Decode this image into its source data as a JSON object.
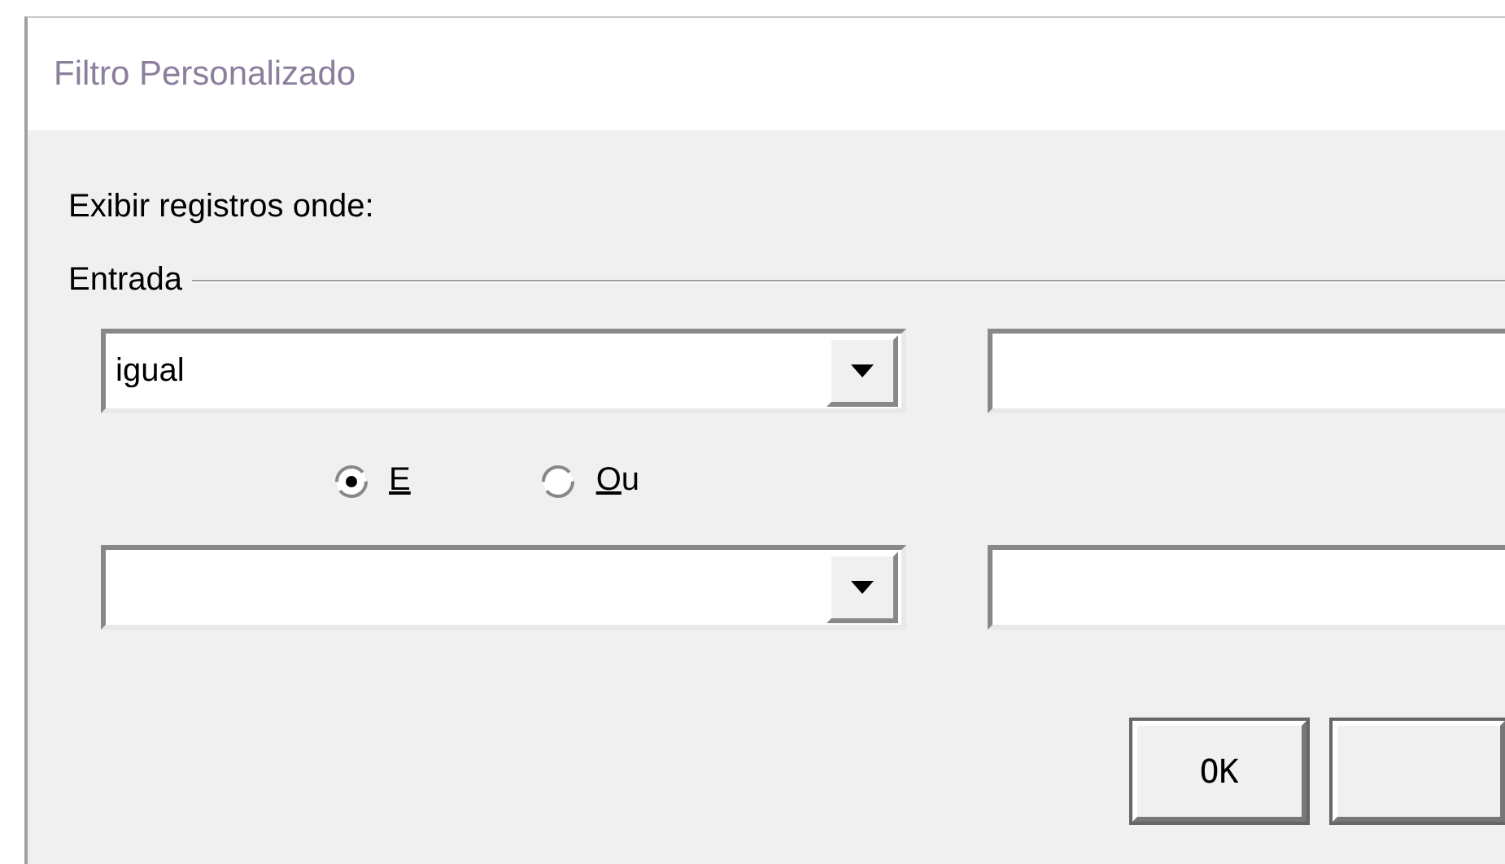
{
  "window": {
    "title": "Filtro Personalizado"
  },
  "prompt": "Exibir registros onde:",
  "group": {
    "label": "Entrada"
  },
  "conditions": [
    {
      "kind": "filled",
      "operator": "igual"
    },
    {
      "kind": "blank"
    }
  ],
  "joiners": [
    {
      "label": "E",
      "selected": true
    },
    {
      "label": "Ou",
      "selected": false
    }
  ],
  "buttons": [
    {
      "label": "OK"
    }
  ]
}
